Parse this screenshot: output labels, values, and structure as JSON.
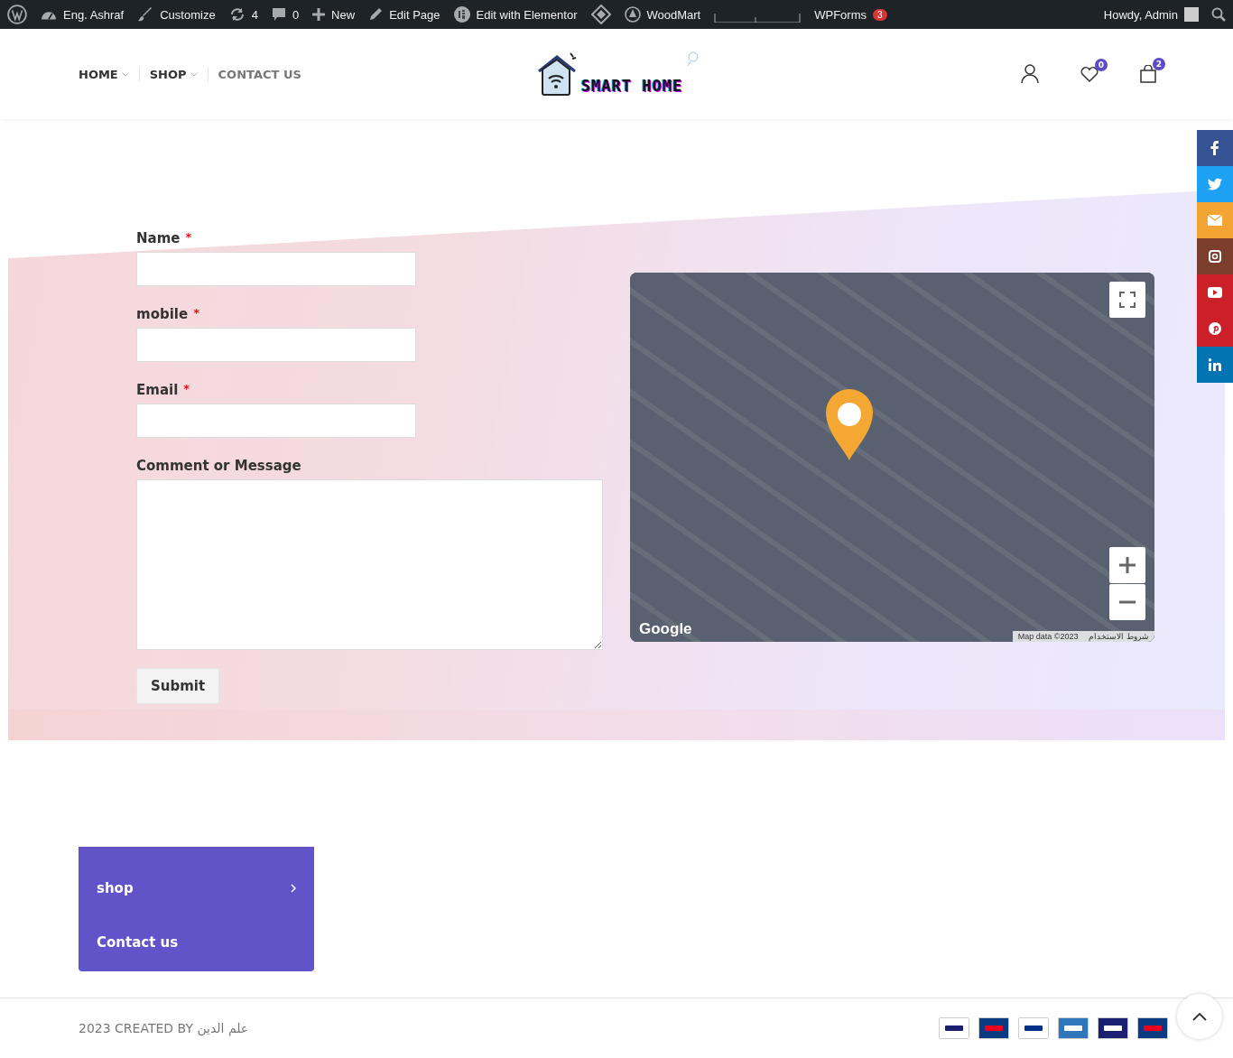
{
  "admin_bar": {
    "items": [
      {
        "kind": "wp"
      },
      {
        "kind": "dashboard",
        "label": "Eng. Ashraf"
      },
      {
        "kind": "brush",
        "label": "Customize"
      },
      {
        "kind": "update",
        "label": "4"
      },
      {
        "kind": "comment",
        "label": "0"
      },
      {
        "kind": "plus",
        "label": "New"
      },
      {
        "kind": "pencil",
        "label": "Edit Page"
      },
      {
        "kind": "elementor",
        "label": "Edit with Elementor"
      },
      {
        "kind": "diamond"
      },
      {
        "kind": "woodmart",
        "label": "WoodMart"
      },
      {
        "kind": "graph"
      },
      {
        "kind": "text",
        "label": "WPForms",
        "badge": "3"
      }
    ],
    "account": "Howdy, Admin"
  },
  "header": {
    "nav": [
      {
        "label": "HOME",
        "dropdown": true,
        "selected": false
      },
      {
        "label": "SHOP",
        "dropdown": true,
        "selected": false
      },
      {
        "label": "CONTACT US",
        "dropdown": false,
        "selected": true
      }
    ],
    "logo": "SMART HOME",
    "wishlist_count": "0",
    "cart_count": "2"
  },
  "social": [
    {
      "kind": "facebook",
      "color": "#365493"
    },
    {
      "kind": "twitter",
      "color": "#1da1f2"
    },
    {
      "kind": "email",
      "color": "#f3a533"
    },
    {
      "kind": "instagram",
      "color": "#7a3e2c"
    },
    {
      "kind": "youtube",
      "color": "#cb2027"
    },
    {
      "kind": "pinterest",
      "color": "#cb2027"
    },
    {
      "kind": "linkedin",
      "color": "#0274b3"
    }
  ],
  "form": {
    "fields": [
      {
        "label": "Name",
        "required": "*",
        "kind": "input"
      },
      {
        "label": "mobile",
        "required": "*",
        "kind": "input"
      },
      {
        "label": "Email",
        "required": "*",
        "kind": "input"
      },
      {
        "label": "Comment or Message",
        "kind": "textarea"
      }
    ],
    "submit": "Submit"
  },
  "map": {
    "brand": "Google",
    "attribution": "Map data ©2023",
    "terms": "شروط الاستخدام"
  },
  "footer_menu": [
    {
      "label": "shop",
      "has_children": true
    },
    {
      "label": "Contact us",
      "has_children": false
    }
  ],
  "footer": {
    "copyright": "2023 CREATED BY علم الدين",
    "payments": [
      {
        "kind": "visa"
      },
      {
        "kind": "mastercard"
      },
      {
        "kind": "paypal"
      },
      {
        "kind": "amex"
      },
      {
        "kind": "visa-electron"
      },
      {
        "kind": "maestro"
      }
    ]
  }
}
